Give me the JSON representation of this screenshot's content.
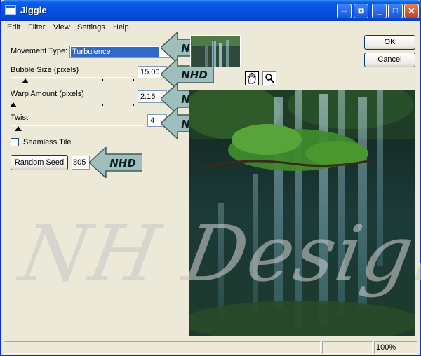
{
  "window": {
    "title": "Jiggle",
    "icons": [
      "app-window-icon",
      "help-icon",
      "restore-icon",
      "minimize-icon",
      "maximize-icon",
      "close-icon"
    ]
  },
  "menu": [
    "Edit",
    "Filter",
    "View",
    "Settings",
    "Help"
  ],
  "controls": {
    "movement_type_label": "Movement Type:",
    "movement_type_value": "Turbulence",
    "bubble_size_label": "Bubble Size (pixels)",
    "bubble_size_value": "15.00",
    "bubble_size_level": 0.12,
    "warp_amount_label": "Warp Amount (pixels)",
    "warp_amount_value": "2.16",
    "warp_amount_level": 0.02,
    "twist_label": "Twist",
    "twist_value": "4",
    "twist_level": 0.06,
    "seamless_tile_label": "Seamless Tile",
    "seamless_tile_checked": false,
    "random_seed_label": "Random Seed",
    "random_seed_value": "805"
  },
  "buttons": {
    "ok": "OK",
    "cancel": "Cancel"
  },
  "badges": {
    "nhd": "NHD"
  },
  "watermark": "NH Designs",
  "status": {
    "zoom": "100%"
  },
  "colors": {
    "title_bar": "#0554e0",
    "selection": "#316ac5",
    "badge": "#9fbfbc"
  }
}
